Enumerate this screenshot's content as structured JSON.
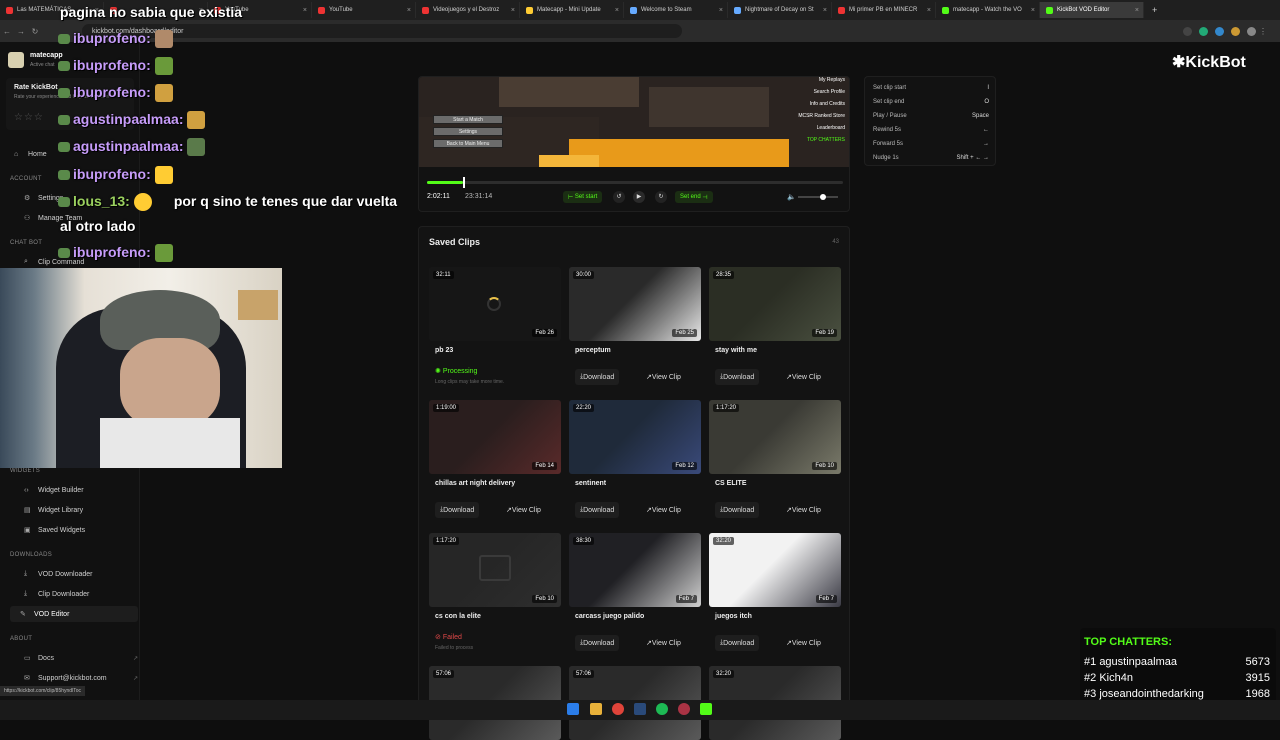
{
  "browser": {
    "tabs": [
      {
        "title": "Las MATEMÁTICAS",
        "color": "#e33"
      },
      {
        "title": "",
        "color": "#e33"
      },
      {
        "title": "YouTube",
        "color": "#e33"
      },
      {
        "title": "YouTube",
        "color": "#e33"
      },
      {
        "title": "Videojuegos y el Destroz",
        "color": "#e33"
      },
      {
        "title": "Matecapp - Mini Update",
        "color": "#fc3"
      },
      {
        "title": "Welcome to Steam",
        "color": "#6af"
      },
      {
        "title": "Nightmare of Decay on St",
        "color": "#6af"
      },
      {
        "title": "Mi primer PB en MINECR",
        "color": "#e33"
      },
      {
        "title": "matecapp - Watch the VO",
        "color": "#53fc18"
      },
      {
        "title": "KickBot VOD Editor",
        "color": "#53fc18"
      }
    ],
    "url": "kickbot.com/dashboard/editor",
    "status_url": "https://kickbot.com/clip/85hyndlToc"
  },
  "sidebar": {
    "user": "matecapp",
    "user_sub": "Active chat",
    "rate_title": "Rate KickBot",
    "rate_text": "Rate your experience and help us improve!",
    "sections": {
      "account": "ACCOUNT",
      "chatbot": "CHAT BOT",
      "widgets": "WIDGETS",
      "downloads": "DOWNLOADS",
      "about": "ABOUT"
    },
    "items": {
      "home": "Home",
      "settings": "Settings",
      "manage_team": "Manage Team",
      "clip_command": "Clip Command",
      "widget_builder": "Widget Builder",
      "widget_library": "Widget Library",
      "saved_widgets": "Saved Widgets",
      "vod_downloader": "VOD Downloader",
      "clip_downloader": "Clip Downloader",
      "vod_editor": "VOD Editor",
      "docs": "Docs",
      "support": "Support@kickbot.com"
    }
  },
  "brand": {
    "logo": "✱KickBot",
    "accent": "#53fc18"
  },
  "player": {
    "menu_buttons": [
      "Start a Match",
      "Settings",
      "Back to Main Menu"
    ],
    "side_menu": [
      "My Replays",
      "Search Profile",
      "Info and Credits",
      "MCSR Ranked Store",
      "Leaderboard"
    ],
    "top_chatters_small": "TOP CHATTERS",
    "current_time": "2:02:11",
    "total_time": "23:31:14",
    "progress": 0.087,
    "set_start": "Set start",
    "set_end": "Set end"
  },
  "shortcuts": [
    {
      "label": "Set clip start",
      "key": "I"
    },
    {
      "label": "Set clip end",
      "key": "O"
    },
    {
      "label": "Play / Pause",
      "key": "Space"
    },
    {
      "label": "Rewind 5s",
      "key": "←"
    },
    {
      "label": "Forward 5s",
      "key": "→"
    },
    {
      "label": "Nudge 1s",
      "key": "Shift + ← →"
    }
  ],
  "clips": {
    "title": "Saved Clips",
    "count": "43",
    "download_label": "Download",
    "view_label": "View Clip",
    "items": [
      {
        "title": "pb 23",
        "duration": "32:11",
        "date": "Feb 26",
        "status": "Processing",
        "note": "Long clips may take more time.",
        "state": "processing"
      },
      {
        "title": "perceptum",
        "duration": "30:00",
        "date": "Feb 25",
        "state": "ready"
      },
      {
        "title": "stay with me",
        "duration": "28:35",
        "date": "Feb 19",
        "state": "ready"
      },
      {
        "title": "chillas art night delivery",
        "duration": "1:19:00",
        "date": "Feb 14",
        "state": "ready"
      },
      {
        "title": "sentinent",
        "duration": "22:20",
        "date": "Feb 12",
        "state": "ready"
      },
      {
        "title": "CS ELITE",
        "duration": "1:17:20",
        "date": "Feb 10",
        "state": "ready"
      },
      {
        "title": "cs con la elite",
        "duration": "1:17:20",
        "date": "Feb 10",
        "status": "Failed",
        "note": "Failed to process",
        "state": "failed"
      },
      {
        "title": "carcass juego palido",
        "duration": "38:30",
        "date": "Feb 7",
        "state": "ready"
      },
      {
        "title": "juegos itch",
        "duration": "32:20",
        "date": "Feb 7",
        "state": "ready"
      },
      {
        "title": "",
        "duration": "57:06",
        "date": "",
        "state": "ready"
      },
      {
        "title": "",
        "duration": "57:06",
        "date": "",
        "state": "ready"
      },
      {
        "title": "",
        "duration": "32:20",
        "date": "",
        "state": "ready"
      }
    ]
  },
  "overlay_chat": [
    {
      "user": "",
      "msg": "pagina no sabia que existia"
    },
    {
      "user": "ibuprofeno:",
      "msg": ""
    },
    {
      "user": "ibuprofeno:",
      "msg": ""
    },
    {
      "user": "ibuprofeno:",
      "msg": ""
    },
    {
      "user": "agustinpaalmaa:",
      "msg": ""
    },
    {
      "user": "agustinpaalmaa:",
      "msg": ""
    },
    {
      "user": "ibuprofeno:",
      "msg": ""
    },
    {
      "user": "lous_13:",
      "msg": "por q sino te tenes que dar vuelta"
    },
    {
      "user": "",
      "msg": "al otro lado"
    },
    {
      "user": "ibuprofeno:",
      "msg": ""
    }
  ],
  "top_chatters": {
    "title": "TOP CHATTERS:",
    "rows": [
      {
        "rank": "#1",
        "name": "agustinpaalmaa",
        "count": "5673"
      },
      {
        "rank": "#2",
        "name": "Kich4n",
        "count": "3915"
      },
      {
        "rank": "#3",
        "name": "joseandointhedarking",
        "count": "1968"
      }
    ]
  }
}
